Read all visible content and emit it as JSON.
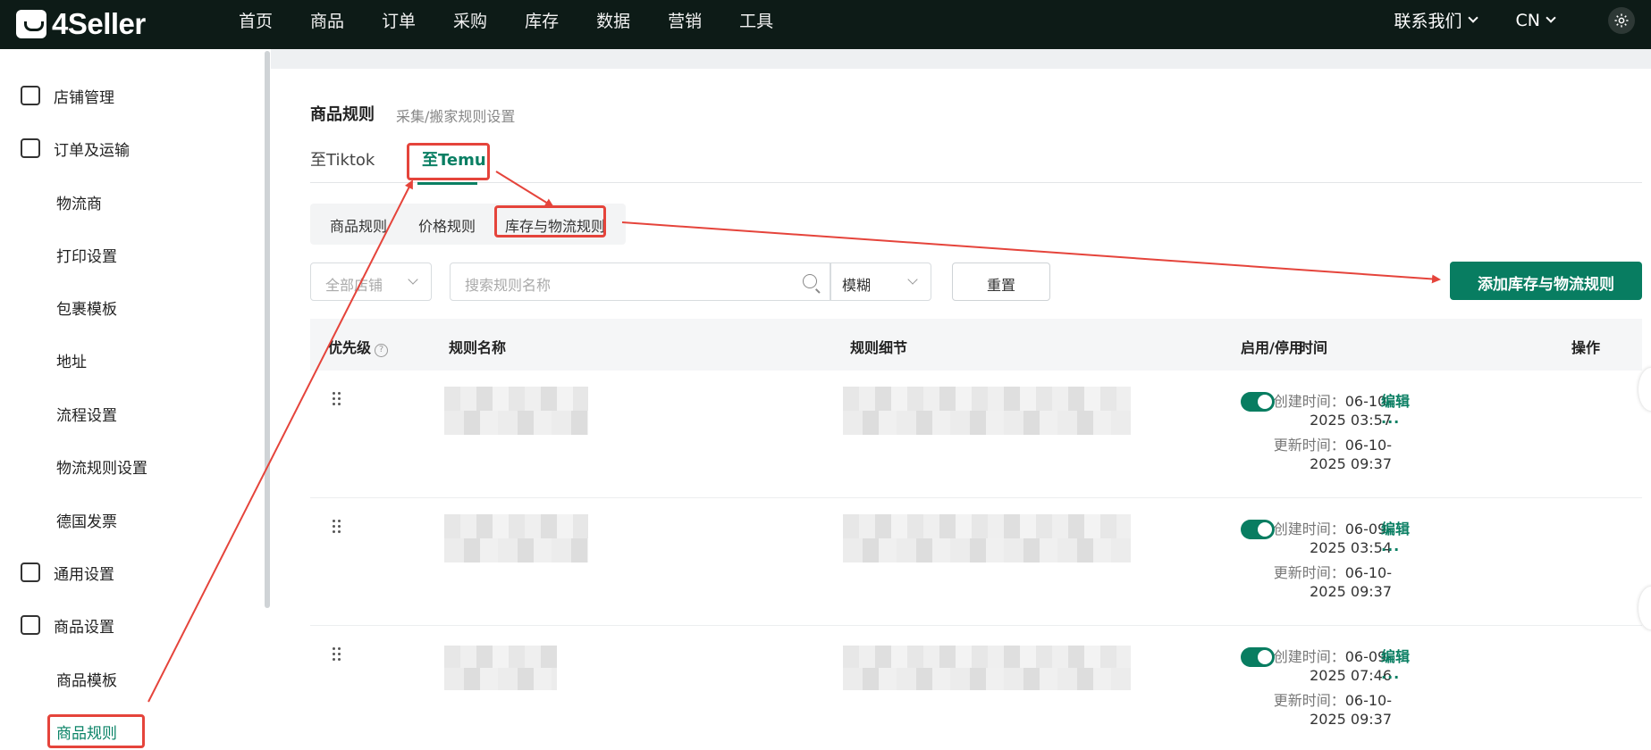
{
  "app": {
    "logo": "4Seller"
  },
  "nav": {
    "items": [
      "首页",
      "商品",
      "订单",
      "采购",
      "库存",
      "数据",
      "营销",
      "工具"
    ]
  },
  "top_right": {
    "contact": "联系我们",
    "lang": "CN"
  },
  "sidebar": {
    "items": [
      {
        "label": "店铺管理"
      },
      {
        "label": "订单及运输"
      },
      {
        "label": "物流商"
      },
      {
        "label": "打印设置"
      },
      {
        "label": "包裹模板"
      },
      {
        "label": "地址"
      },
      {
        "label": "流程设置"
      },
      {
        "label": "物流规则设置"
      },
      {
        "label": "德国发票"
      },
      {
        "label": "通用设置"
      },
      {
        "label": "商品设置"
      },
      {
        "label": "商品模板"
      },
      {
        "label": "商品规则"
      }
    ]
  },
  "page": {
    "title": "商品规则",
    "subtitle": "采集/搬家规则设置"
  },
  "tabs": [
    "至Tiktok",
    "至Temu"
  ],
  "segments": [
    "商品规则",
    "价格规则",
    "库存与物流规则"
  ],
  "filters": {
    "store_placeholder": "全部店铺",
    "search_placeholder": "搜索规则名称",
    "mode": "模糊",
    "reset": "重置",
    "add_button": "添加库存与物流规则"
  },
  "table": {
    "headers": {
      "priority": "优先级",
      "name": "规则名称",
      "detail": "规则细节",
      "time": "时间",
      "toggle": "启用/停用",
      "action": "操作"
    },
    "rows": [
      {
        "created_label": "创建时间：",
        "created_1": "06-10-",
        "created_2": "2025 03:57",
        "updated_label": "更新时间：",
        "updated_1": "06-10-",
        "updated_2": "2025 09:37",
        "edit": "编辑",
        "more": "...",
        "enabled": true
      },
      {
        "created_label": "创建时间：",
        "created_1": "06-09-",
        "created_2": "2025 03:54",
        "updated_label": "更新时间：",
        "updated_1": "06-10-",
        "updated_2": "2025 09:37",
        "edit": "编辑",
        "more": "...",
        "enabled": true
      },
      {
        "created_label": "创建时间：",
        "created_1": "06-09-",
        "created_2": "2025 07:46",
        "updated_label": "更新时间：",
        "updated_1": "06-10-",
        "updated_2": "2025 09:37",
        "edit": "编辑",
        "more": "...",
        "enabled": true
      }
    ]
  },
  "colors": {
    "accent": "#087d61",
    "annotation": "#e5443b",
    "topbar": "#0d1b17"
  }
}
